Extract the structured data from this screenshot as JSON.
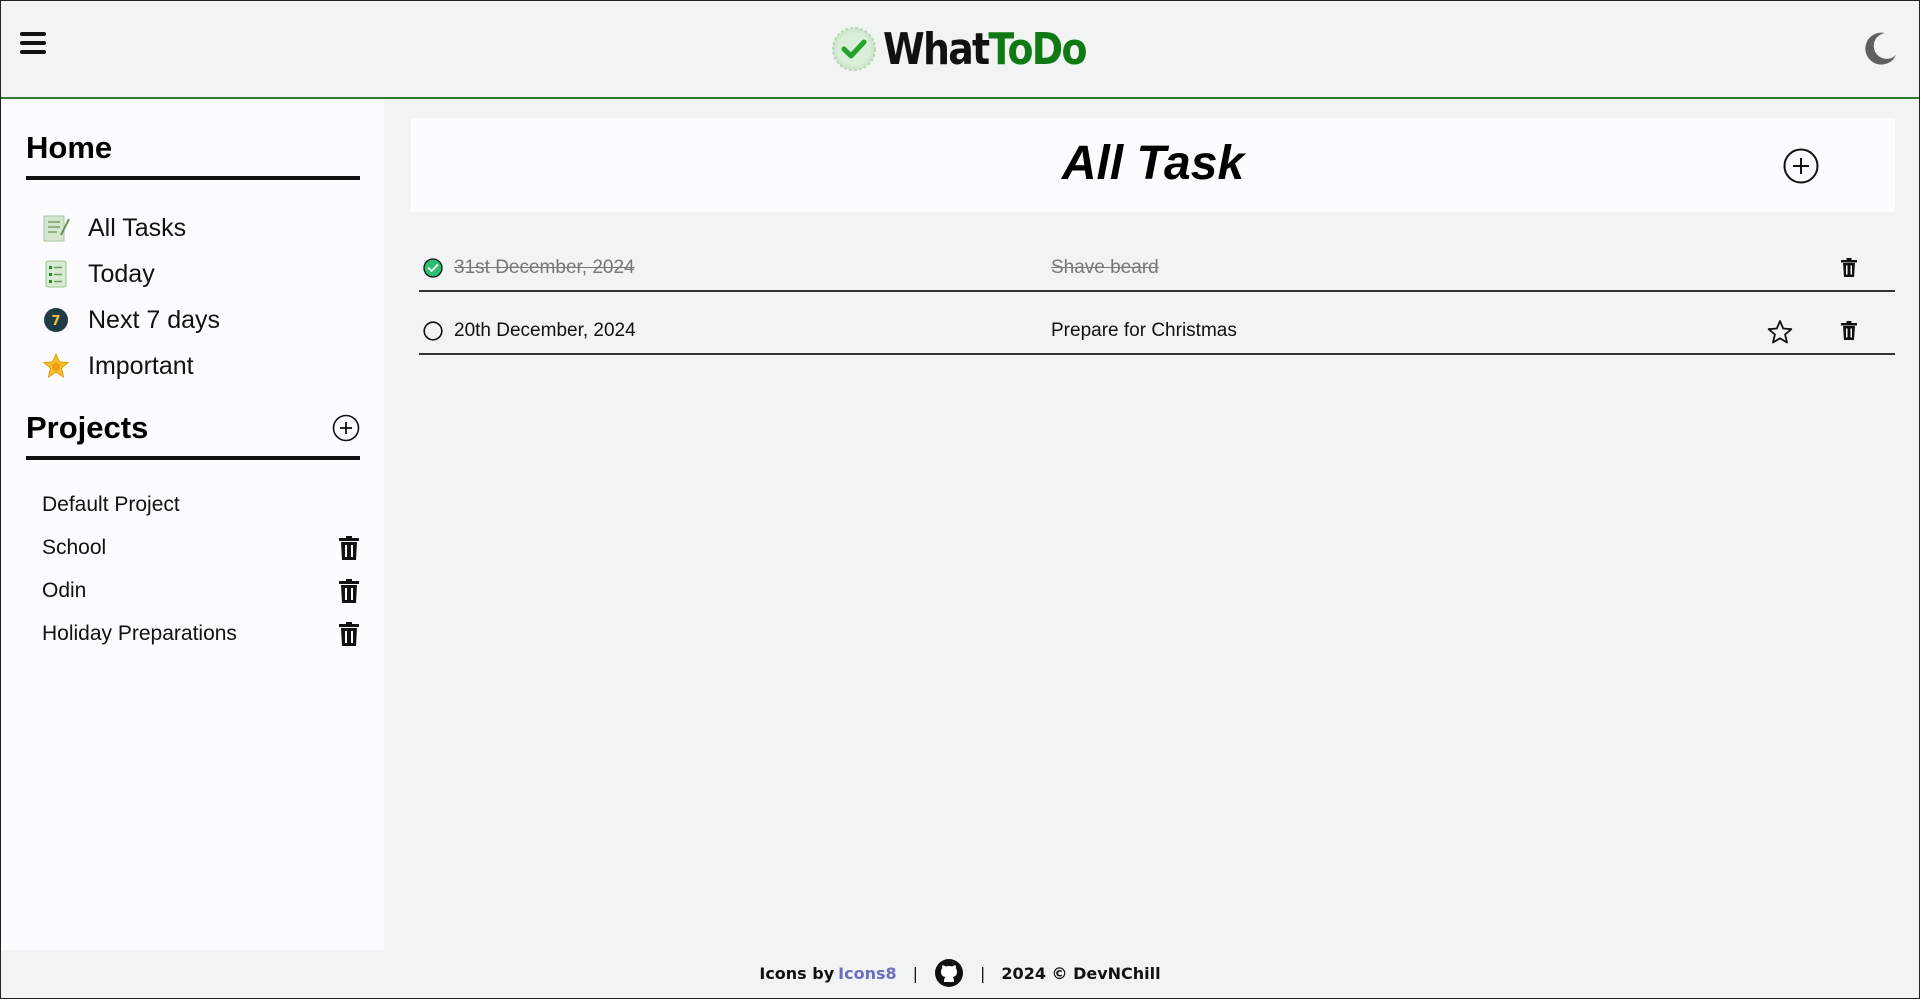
{
  "header": {
    "menu_icon": "hamburger-icon",
    "logo_part1": "What",
    "logo_part2": "ToDo",
    "logo_badge": "check-badge-icon",
    "theme_icon": "moon-icon"
  },
  "sidebar": {
    "home_heading": "Home",
    "nav": [
      {
        "label": "All Tasks",
        "icon": "notebook-icon"
      },
      {
        "label": "Today",
        "icon": "checklist-icon"
      },
      {
        "label": "Next 7 days",
        "icon": "seven-badge-icon"
      },
      {
        "label": "Important",
        "icon": "star-icon"
      }
    ],
    "projects_heading": "Projects",
    "projects": [
      {
        "label": "Default Project",
        "deletable": false
      },
      {
        "label": "School",
        "deletable": true
      },
      {
        "label": "Odin",
        "deletable": true
      },
      {
        "label": "Holiday Preparations",
        "deletable": true
      }
    ]
  },
  "main": {
    "title": "All Task",
    "tasks": [
      {
        "date": "31st December, 2024",
        "name": "Shave beard",
        "done": true
      },
      {
        "date": "20th December, 2024",
        "name": "Prepare for Christmas",
        "done": false
      }
    ]
  },
  "footer": {
    "credit_prefix": "Icons by",
    "credit_link": "Icons8",
    "separator": "|",
    "copyright": "2024 © DevNChill"
  },
  "colors": {
    "accent_green": "#0f7a14",
    "check_green": "#2fbf71",
    "link": "#6b6fc0"
  }
}
